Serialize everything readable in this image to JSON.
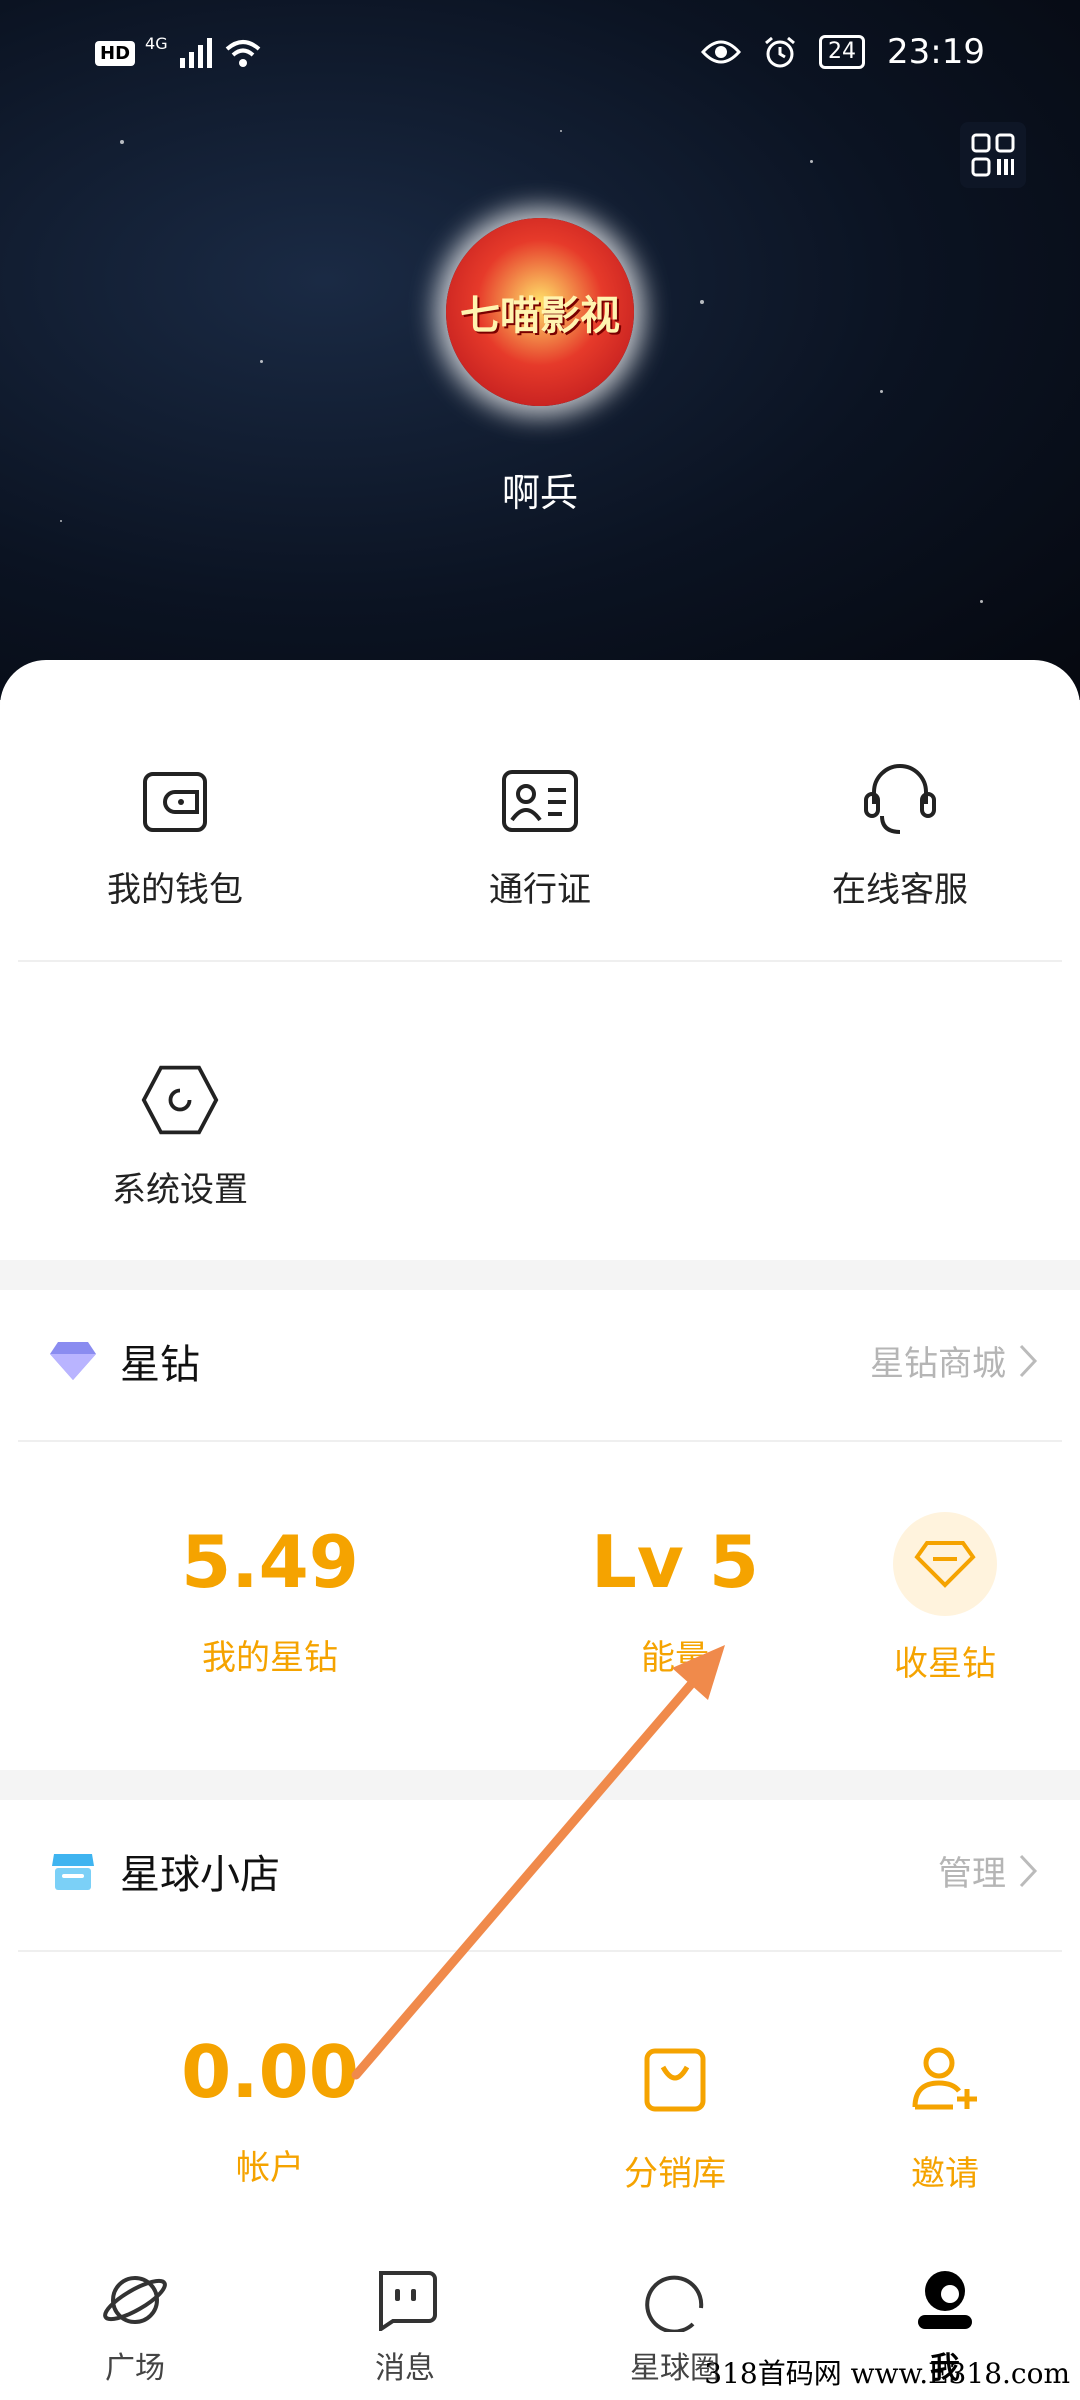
{
  "status": {
    "net": "4G",
    "hd": "HD",
    "battery": "24",
    "time": "23:19"
  },
  "profile": {
    "avatar_text": "七喵影视",
    "name": "啊兵"
  },
  "menu": [
    {
      "label": "我的钱包",
      "icon": "wallet-icon"
    },
    {
      "label": "通行证",
      "icon": "id-card-icon"
    },
    {
      "label": "在线客服",
      "icon": "headset-icon"
    },
    {
      "label": "系统设置",
      "icon": "settings-hex-icon"
    }
  ],
  "diamond": {
    "title": "星钻",
    "more": "星钻商城",
    "balance_value": "5.49",
    "balance_label": "我的星钻",
    "energy_value": "Lv 5",
    "energy_label": "能量",
    "collect_label": "收星钻"
  },
  "shop": {
    "title": "星球小店",
    "more": "管理",
    "account_value": "0.00",
    "account_label": "帐户",
    "distribution_label": "分销库",
    "invite_label": "邀请"
  },
  "tabs": [
    {
      "label": "广场",
      "icon": "planet-icon"
    },
    {
      "label": "消息",
      "icon": "message-icon"
    },
    {
      "label": "星球圈",
      "icon": "circle-icon"
    },
    {
      "label": "我",
      "icon": "profile-icon",
      "active": true
    }
  ],
  "watermark": "318首码网 www.E318.com",
  "colors": {
    "accent": "#f5a300",
    "hero_bg": "#0b1322"
  }
}
